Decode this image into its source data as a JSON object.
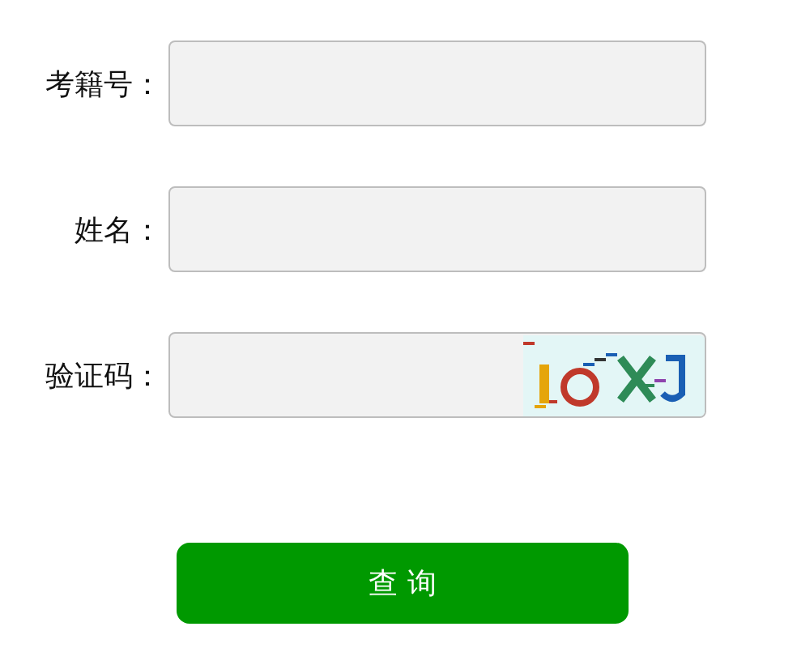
{
  "fields": [
    {
      "label": "考籍号：",
      "kind": "text"
    },
    {
      "label": "姓名：",
      "kind": "text"
    },
    {
      "label": "验证码：",
      "kind": "captcha"
    }
  ],
  "submit": {
    "label": "查 询"
  }
}
